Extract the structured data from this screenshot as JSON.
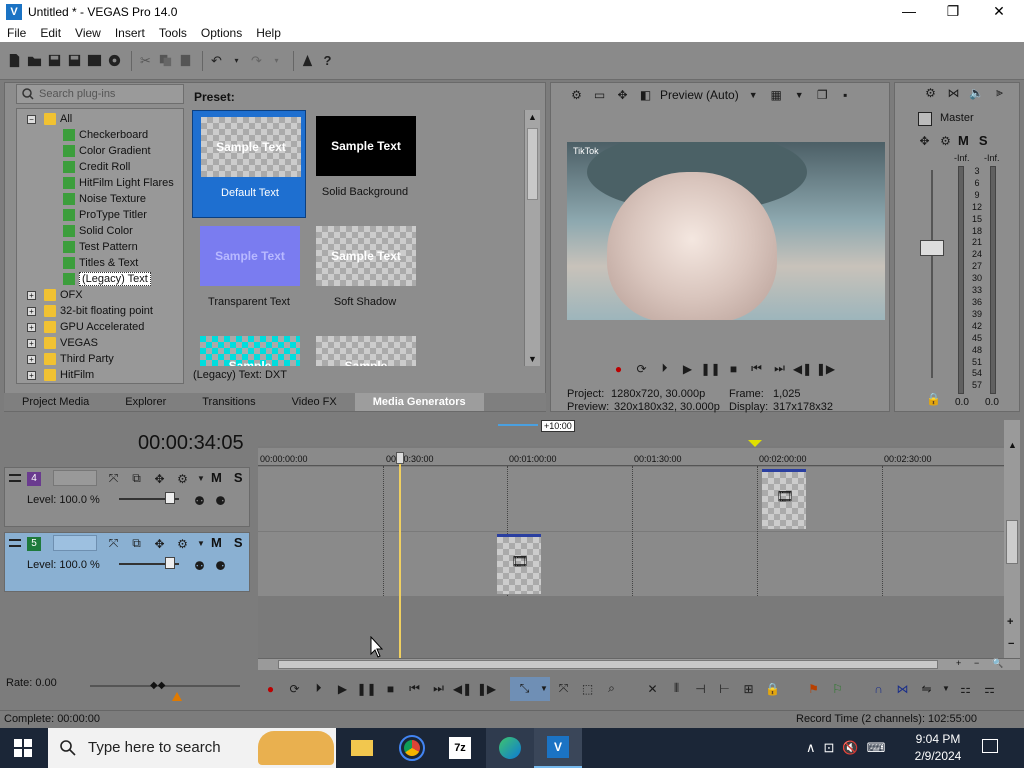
{
  "window": {
    "title": "Untitled * - VEGAS Pro 14.0",
    "app_icon": "vegas-logo",
    "minimize": "—",
    "maximize": "❐",
    "close": "✕"
  },
  "menu": [
    "File",
    "Edit",
    "View",
    "Insert",
    "Tools",
    "Options",
    "Help"
  ],
  "plugins": {
    "search_placeholder": "Search plug-ins",
    "tree": [
      {
        "label": "All",
        "type": "folder",
        "expanded": true
      },
      {
        "label": "Checkerboard",
        "type": "plugin"
      },
      {
        "label": "Color Gradient",
        "type": "plugin"
      },
      {
        "label": "Credit Roll",
        "type": "plugin"
      },
      {
        "label": "HitFilm Light Flares",
        "type": "plugin"
      },
      {
        "label": "Noise Texture",
        "type": "plugin"
      },
      {
        "label": "ProType Titler",
        "type": "plugin"
      },
      {
        "label": "Solid Color",
        "type": "plugin"
      },
      {
        "label": "Test Pattern",
        "type": "plugin"
      },
      {
        "label": "Titles & Text",
        "type": "plugin"
      },
      {
        "label": "(Legacy) Text",
        "type": "plugin",
        "selected": true
      },
      {
        "label": "OFX",
        "type": "folder"
      },
      {
        "label": "32-bit floating point",
        "type": "folder"
      },
      {
        "label": "GPU Accelerated",
        "type": "folder"
      },
      {
        "label": "VEGAS",
        "type": "folder"
      },
      {
        "label": "Third Party",
        "type": "folder"
      },
      {
        "label": "HitFilm",
        "type": "folder"
      }
    ],
    "preset_heading": "Preset:",
    "presets": [
      {
        "label": "Default Text",
        "thumb_text": "Sample Text",
        "style": "checker",
        "selected": true
      },
      {
        "label": "Solid Background",
        "thumb_text": "Sample Text",
        "style": "black"
      },
      {
        "label": "Transparent Text",
        "thumb_text": "Sample Text",
        "style": "purple"
      },
      {
        "label": "Soft Shadow",
        "thumb_text": "Sample Text",
        "style": "checker"
      },
      {
        "label": "",
        "thumb_text": "Sample",
        "style": "checker-cyan"
      },
      {
        "label": "",
        "thumb_text": "Sample",
        "style": "checker"
      }
    ],
    "status": "(Legacy) Text: DXT"
  },
  "tabs": [
    "Project Media",
    "Explorer",
    "Transitions",
    "Video FX",
    "Media Generators"
  ],
  "active_tab": "Media Generators",
  "preview": {
    "mode": "Preview (Auto)",
    "overlay_text": "TikTok",
    "info": {
      "project_label": "Project:",
      "project_value": "1280x720, 30.000p",
      "frame_label": "Frame:",
      "frame_value": "1,025",
      "preview_label": "Preview:",
      "preview_value": "320x180x32, 30.000p",
      "display_label": "Display:",
      "display_value": "317x178x32"
    }
  },
  "master": {
    "title": "Master",
    "m": "M",
    "s": "S",
    "inf_left": "-Inf.",
    "inf_right": "-Inf.",
    "scale": [
      "3",
      "6",
      "9",
      "12",
      "15",
      "18",
      "21",
      "24",
      "27",
      "30",
      "33",
      "36",
      "39",
      "42",
      "45",
      "48",
      "51",
      "54",
      "57"
    ],
    "value_left": "0.0",
    "value_right": "0.0"
  },
  "timeline": {
    "timecode": "00:00:34:05",
    "zoom_label": "+10:00",
    "ruler": [
      "00:00:00:00",
      "00:00:30:00",
      "00:01:00:00",
      "00:01:30:00",
      "00:02:00:00",
      "00:02:30:00"
    ],
    "tracks": [
      {
        "number": "4",
        "level": "Level: 100.0 %",
        "m": "M",
        "s": "S",
        "selected": false
      },
      {
        "number": "5",
        "level": "Level: 100.0 %",
        "m": "M",
        "s": "S",
        "selected": true
      }
    ]
  },
  "bottom": {
    "rate": "Rate: 0.00",
    "complete": "Complete: 00:00:00",
    "record_time": "Record Time (2 channels): 102:55:00"
  },
  "taskbar": {
    "search_placeholder": "Type here to search",
    "time": "9:04 PM",
    "date": "2/9/2024"
  },
  "colors": {
    "selected_preset": "#1e6fd0",
    "track_selected": "#8ab0d2",
    "playhead": "#f0d060",
    "taskbar": "#1b2637"
  }
}
